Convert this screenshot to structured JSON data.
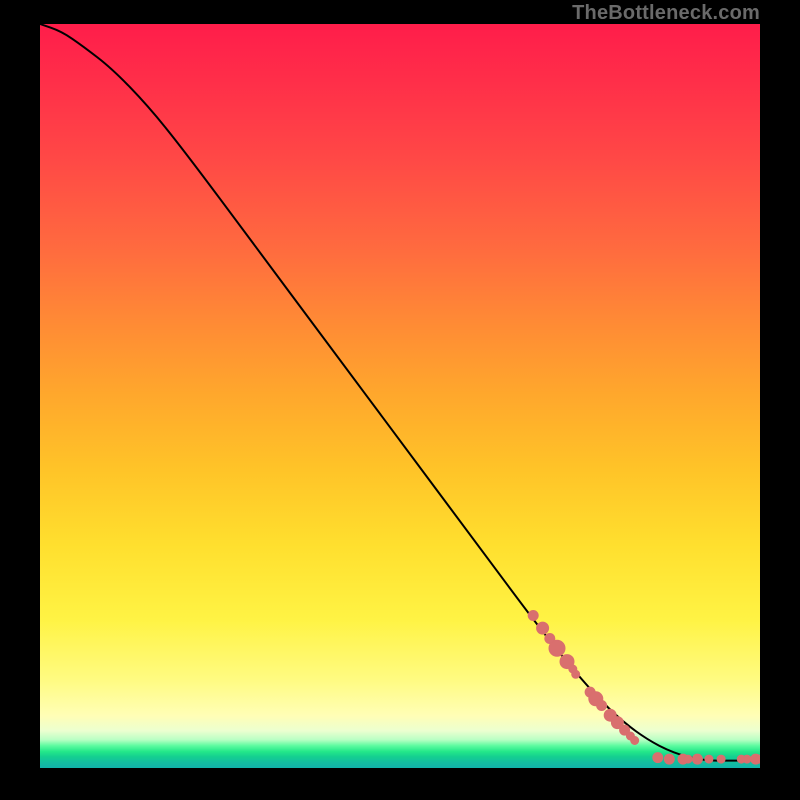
{
  "attribution": "TheBottleneck.com",
  "chart_data": {
    "type": "line",
    "title": "",
    "xlabel": "",
    "ylabel": "",
    "xlim": [
      0,
      100
    ],
    "ylim": [
      0,
      100
    ],
    "series": [
      {
        "name": "curve",
        "x": [
          0,
          3,
          6,
          10,
          15,
          20,
          30,
          40,
          50,
          60,
          70,
          76,
          80,
          84,
          88,
          92,
          96,
          100
        ],
        "y": [
          100,
          99,
          97,
          94,
          89,
          83,
          70,
          57,
          44,
          31,
          18,
          11,
          7,
          4,
          2,
          1,
          1,
          1
        ]
      }
    ],
    "scatter_clusters": [
      {
        "name": "cluster-upper",
        "points": [
          [
            68.5,
            20.5,
            5
          ],
          [
            69.8,
            18.8,
            6
          ],
          [
            70.8,
            17.4,
            5
          ],
          [
            71.8,
            16.1,
            8
          ],
          [
            73.2,
            14.3,
            7
          ],
          [
            74.0,
            13.3,
            4
          ],
          [
            74.4,
            12.6,
            4
          ]
        ]
      },
      {
        "name": "cluster-lower",
        "points": [
          [
            76.4,
            10.2,
            5
          ],
          [
            77.2,
            9.3,
            7
          ],
          [
            78.0,
            8.4,
            5
          ],
          [
            79.2,
            7.1,
            6
          ],
          [
            80.2,
            6.1,
            6
          ],
          [
            81.2,
            5.1,
            5
          ],
          [
            82.0,
            4.3,
            4
          ],
          [
            82.6,
            3.7,
            4
          ]
        ]
      },
      {
        "name": "cluster-flat",
        "points": [
          [
            85.8,
            1.4,
            5
          ],
          [
            87.4,
            1.2,
            5
          ],
          [
            89.3,
            1.2,
            5
          ],
          [
            90.0,
            1.2,
            4
          ],
          [
            91.3,
            1.2,
            5
          ],
          [
            92.9,
            1.2,
            4
          ],
          [
            94.6,
            1.2,
            4
          ],
          [
            97.4,
            1.2,
            4
          ],
          [
            98.2,
            1.2,
            4
          ],
          [
            99.4,
            1.2,
            5
          ],
          [
            100.0,
            1.2,
            4
          ]
        ]
      }
    ]
  }
}
